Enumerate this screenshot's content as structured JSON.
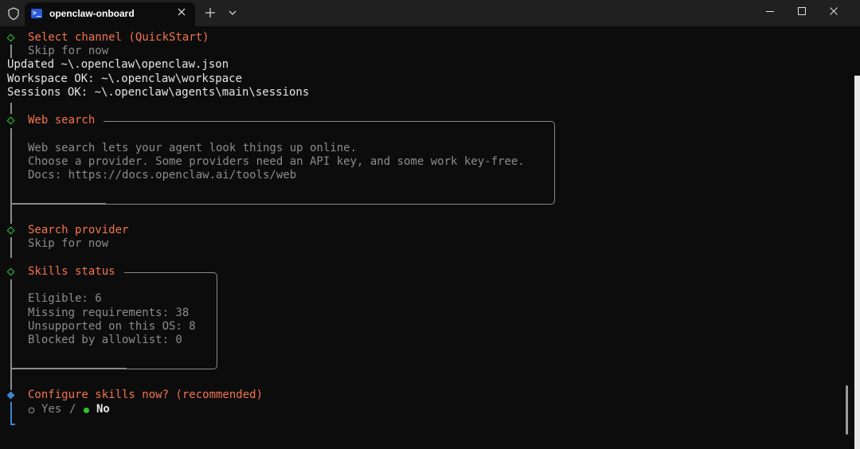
{
  "titlebar": {
    "tab_title": "openclaw-onboard",
    "tab_icon_glyph": ">_",
    "icons": [
      "shield-icon",
      "powershell-icon",
      "close-icon",
      "plus-icon",
      "chevron-down-icon",
      "minimize-icon",
      "maximize-icon",
      "close-icon"
    ]
  },
  "terminal": {
    "select_channel": {
      "title": "Select channel (QuickStart)",
      "value": "Skip for now"
    },
    "log_lines": [
      "Updated ~\\.openclaw\\openclaw.json",
      "Workspace OK: ~\\.openclaw\\workspace",
      "Sessions OK: ~\\.openclaw\\agents\\main\\sessions"
    ],
    "web_search": {
      "title": "Web search",
      "lines": [
        "Web search lets your agent look things up online.",
        "Choose a provider. Some providers need an API key, and some work key-free.",
        "Docs: https://docs.openclaw.ai/tools/web"
      ]
    },
    "search_provider": {
      "title": "Search provider",
      "value": "Skip for now"
    },
    "skills_status": {
      "title": "Skills status",
      "lines": [
        "Eligible: 6",
        "Missing requirements: 38",
        "Unsupported on this OS: 8",
        "Blocked by allowlist: 0"
      ]
    },
    "configure": {
      "title": "Configure skills now? (recommended)",
      "option_yes": "Yes",
      "separator": "/",
      "option_no": "No",
      "selected": "No"
    }
  },
  "colors": {
    "accent_orange": "#f2734a",
    "diamond_green": "#2ec42e",
    "active_blue": "#3a86d4",
    "radio_selected": "#2ec42e"
  }
}
